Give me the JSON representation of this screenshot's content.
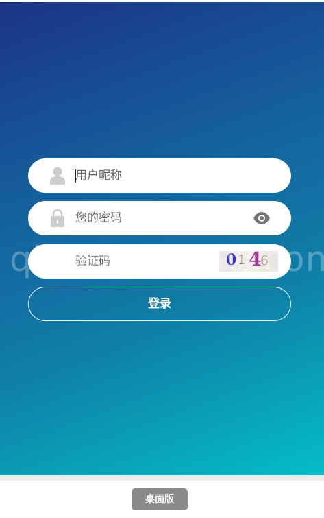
{
  "login": {
    "username_placeholder": "用户昵称",
    "password_placeholder": "您的密码",
    "captcha_placeholder": "验证码",
    "captcha_text": "0146",
    "submit_label": "登录"
  },
  "watermark": "qingfengymw.com",
  "footer": {
    "desktop_label": "桌面版"
  },
  "icons": {
    "username": "user-icon",
    "password": "lock-icon",
    "show_password": "eye-icon"
  },
  "colors": {
    "gradient_start": "#1b3386",
    "gradient_end": "#04bdc6",
    "field_bg": "#ffffff",
    "icon_gray": "#cccccc",
    "desktop_button_bg": "#8a8a8a"
  }
}
